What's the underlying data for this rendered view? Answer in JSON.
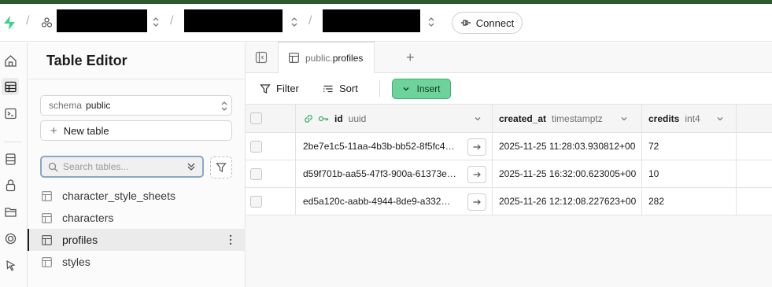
{
  "topbar": {
    "connect_label": "Connect"
  },
  "sidebar": {
    "title": "Table Editor",
    "schema_label": "schema",
    "schema_value": "public",
    "new_table_label": "New table",
    "search_placeholder": "Search tables...",
    "tables": [
      {
        "name": "character_style_sheets",
        "active": false
      },
      {
        "name": "characters",
        "active": false
      },
      {
        "name": "profiles",
        "active": true
      },
      {
        "name": "styles",
        "active": false
      }
    ]
  },
  "tab": {
    "schema": "public.",
    "table": "profiles"
  },
  "toolbar": {
    "filter_label": "Filter",
    "sort_label": "Sort",
    "insert_label": "Insert"
  },
  "grid": {
    "columns": [
      {
        "name": "id",
        "type": "uuid"
      },
      {
        "name": "created_at",
        "type": "timestamptz"
      },
      {
        "name": "credits",
        "type": "int4"
      }
    ],
    "rows": [
      {
        "id": "2be7e1c5-11aa-4b3b-bb52-8f5fc4…",
        "created_at": "2025-11-25 11:28:03.930812+00",
        "credits": "72"
      },
      {
        "id": "d59f701b-aa55-47f3-900a-61373e…",
        "created_at": "2025-11-25 16:32:00.623005+00",
        "credits": "10"
      },
      {
        "id": "ed5a120c-aabb-4944-8de9-a332…",
        "created_at": "2025-11-26 12:12:08.227623+00",
        "credits": "282"
      }
    ]
  },
  "colors": {
    "accent_green": "#6dd39b",
    "top_strip": "#2f5a2f",
    "key_green": "#3fae6d"
  }
}
